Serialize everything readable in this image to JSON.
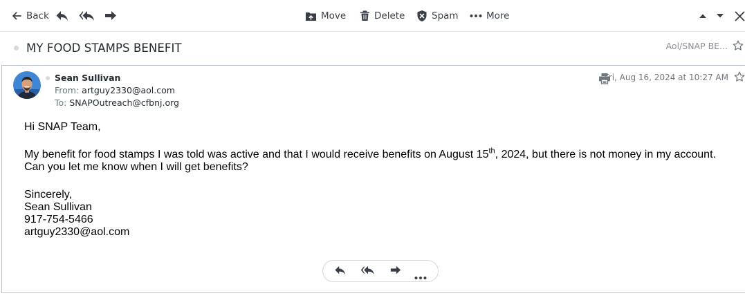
{
  "toolbar": {
    "back_label": "Back",
    "move_label": "Move",
    "delete_label": "Delete",
    "spam_label": "Spam",
    "more_label": "More"
  },
  "subject_row": {
    "subject": "MY FOOD STAMPS BENEFIT",
    "folder": "Aol/SNAP BE..."
  },
  "message": {
    "sender_name": "Sean Sullivan",
    "from_label": "From:",
    "from_email": "artguy2330@aol.com",
    "to_label": "To:",
    "to_email": "SNAPOutreach@cfbnj.org",
    "date": "Fri, Aug 16, 2024 at 10:27 AM",
    "body": {
      "greeting": "Hi SNAP Team,",
      "line1_before_sup": "My benefit for food stamps I was told was active and that I would receive benefits on August 15",
      "line1_sup": "th",
      "line1_after_sup": ", 2024, but there is not money in my account.",
      "line2": "Can you let me know when I will get benefits?",
      "closing": "Sincerely,",
      "sig_name": "Sean Sullivan",
      "sig_phone": "917-754-5466",
      "sig_email": "artguy2330@aol.com"
    }
  },
  "colors": {
    "text": "#232a31",
    "muted": "#6e7780",
    "border": "#b9c0c9",
    "icon": "#3a3f47"
  },
  "icons": {
    "back": "arrow-left-icon",
    "reply": "reply-icon",
    "reply_all": "reply-all-icon",
    "forward": "forward-icon",
    "move": "folder-move-icon",
    "delete": "trash-icon",
    "spam": "shield-spam-icon",
    "more": "dots-horizontal-icon",
    "prev": "caret-up-icon",
    "next": "caret-down-icon",
    "close": "close-icon",
    "star": "star-icon",
    "print": "printer-icon"
  }
}
